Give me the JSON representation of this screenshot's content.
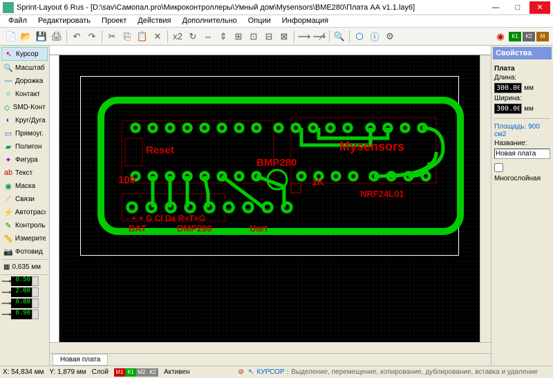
{
  "title": "Sprint-Layout 6 Rus - [D:\\sav\\Самопал.pro\\Микроконтроллеры\\Умный дом\\Mysensors\\BME280\\Плата АА v1.1.lay6]",
  "menu": [
    "Файл",
    "Редактировать",
    "Проект",
    "Действия",
    "Дополнительно",
    "Опции",
    "Информация"
  ],
  "tools": [
    {
      "icon": "↖",
      "label": "Курсор",
      "color": "#c00"
    },
    {
      "icon": "🔍",
      "label": "Масштаб",
      "color": "#06c"
    },
    {
      "icon": "—",
      "label": "Дорожка",
      "color": "#06c"
    },
    {
      "icon": "○",
      "label": "Контакт",
      "color": "#096"
    },
    {
      "icon": "◇",
      "label": "SMD-Контакт",
      "color": "#096"
    },
    {
      "icon": "◐",
      "label": "Круг/Дуга",
      "color": "#06c"
    },
    {
      "icon": "▭",
      "label": "Прямоуг.",
      "color": "#06c"
    },
    {
      "icon": "▰",
      "label": "Полигон",
      "color": "#096"
    },
    {
      "icon": "✦",
      "label": "Фигура",
      "color": "#90c"
    },
    {
      "icon": "ab",
      "label": "Текст",
      "color": "#c00"
    },
    {
      "icon": "◉",
      "label": "Маска",
      "color": "#096"
    },
    {
      "icon": "⟋",
      "label": "Связи",
      "color": "#f80"
    },
    {
      "icon": "⚡",
      "label": "Автотрасса",
      "color": "#06c"
    },
    {
      "icon": "✎",
      "label": "Контроль",
      "color": "#090"
    },
    {
      "icon": "📏",
      "label": "Измеритель",
      "color": "#06c"
    },
    {
      "icon": "📷",
      "label": "Фотовид",
      "color": "#666"
    }
  ],
  "grid_value": "0,635 мм",
  "num_values": [
    "0.50",
    "2.00",
    "0.80",
    "0.90"
  ],
  "pcb_labels": {
    "reset": "Reset",
    "bmp280": "BMP280",
    "mysensors": "Mysensors",
    "hundred": "100",
    "onek": "1K",
    "nrf": "NRF24L01",
    "bat": "BAT",
    "dmp280": "DMP280",
    "uart": "Uart",
    "pins": "- + + G Cl Da R×T×G"
  },
  "tab_name": "Новая плата",
  "props": {
    "header": "Свойства",
    "title": "Плата",
    "length_label": "Длина:",
    "length": "300.00",
    "unit": "мм",
    "width_label": "Ширина:",
    "width": "300.00",
    "area_label": "Площадь: 900 см2",
    "name_label": "Название:",
    "name": "Новая плата",
    "multilayer": "Многослойная"
  },
  "status": {
    "x": "54,834 мм",
    "y": "1,879 мм",
    "active": "Активен",
    "layer_label": "Слой",
    "layers": [
      {
        "name": "М1",
        "color": "#c00"
      },
      {
        "name": "К1",
        "color": "#0a0"
      },
      {
        "name": "М2",
        "color": "#888"
      },
      {
        "name": "К2",
        "color": "#888"
      }
    ],
    "x_label": "X:",
    "y_label": "Y:",
    "cursor_label": "КУРСОР :",
    "cursor_desc": "Выделение, перемещение, копирование, дублирование, вставка и удаление"
  }
}
